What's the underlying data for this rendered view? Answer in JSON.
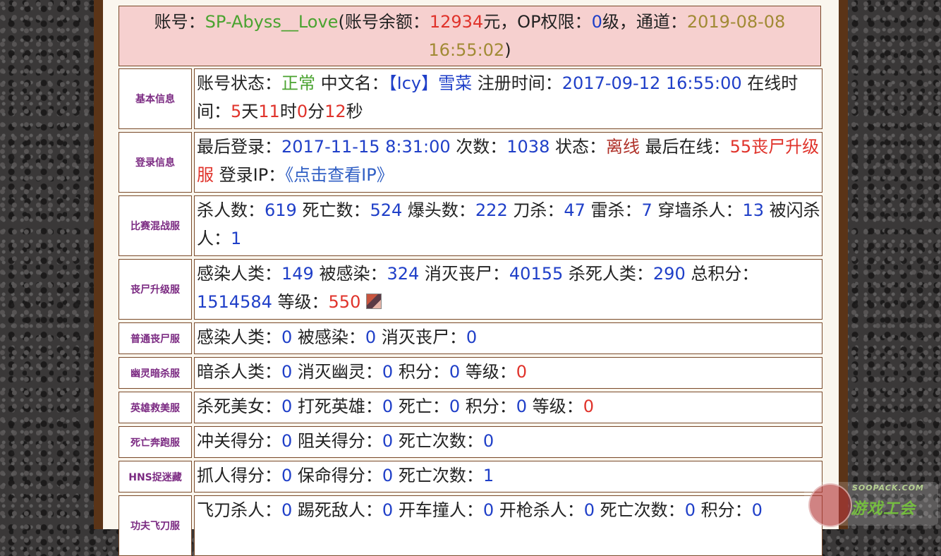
{
  "header": {
    "account_label": "账号：",
    "account_name": "SP-Abyss__Love",
    "balance_open": "(账号余额：",
    "balance_value": "12934",
    "balance_unit": "元，OP权限：",
    "op_level": "0",
    "op_unit": "级，通道：",
    "channel_date": "2019-08-08 16:55:02",
    "close_paren": ")"
  },
  "rows": {
    "basic": {
      "label": "基本信息",
      "status_label": "账号状态：",
      "status_value": "正常",
      "cn_label": " 中文名：",
      "cn_value": "【Icy】雪菜",
      "reg_label": " 注册时间：",
      "reg_value": "2017-09-12 16:55:00",
      "online_label": " 在线时间：",
      "d": "5",
      "d_u": "天",
      "h": "11",
      "h_u": "时",
      "m": "0",
      "m_u": "分",
      "s": "12",
      "s_u": "秒"
    },
    "login": {
      "label": "登录信息",
      "last_label": "最后登录：",
      "last_value": "2017-11-15 8:31:00",
      "count_label": " 次数：",
      "count_value": "1038",
      "state_label": " 状态：",
      "state_value": "离线",
      "lastonline_label": " 最后在线：",
      "lastonline_value": "55丧尸升级服",
      "ip_label": " 登录IP：",
      "ip_link": "《点击查看IP》"
    },
    "mixed": {
      "label": "比赛混战服",
      "kills_label": "杀人数：",
      "kills": "619",
      "deaths_label": " 死亡数：",
      "deaths": "524",
      "hs_label": " 爆头数：",
      "hs": "222",
      "knife_label": " 刀杀：",
      "knife": "47",
      "nade_label": " 雷杀：",
      "nade": "7",
      "wall_label": " 穿墙杀人：",
      "wall": "13",
      "flash_label": " 被闪杀人：",
      "flash": "1"
    },
    "zombie_up": {
      "label": "丧尸升级服",
      "infect_label": "感染人类：",
      "infect": "149",
      "infected_label": " 被感染：",
      "infected": "324",
      "kz_label": " 消灭丧尸：",
      "kz": "40155",
      "kh_label": " 杀死人类：",
      "kh": "290",
      "score_label": " 总积分：",
      "score": "1514584",
      "level_label": " 等级：",
      "level": "550"
    },
    "zombie": {
      "label": "普通丧尸服",
      "infect_label": "感染人类：",
      "infect": "0",
      "infected_label": " 被感染：",
      "infected": "0",
      "kz_label": " 消灭丧尸：",
      "kz": "0"
    },
    "ghost": {
      "label": "幽灵暗杀服",
      "a_label": "暗杀人类：",
      "a": "0",
      "b_label": " 消灭幽灵：",
      "b": "0",
      "c_label": " 积分：",
      "c": "0",
      "d_label": " 等级：",
      "d": "0"
    },
    "hero": {
      "label": "英雄救美服",
      "a_label": "杀死美女：",
      "a": "0",
      "b_label": " 打死英雄：",
      "b": "0",
      "c_label": " 死亡：",
      "c": "0",
      "d_label": " 积分：",
      "d": "0",
      "e_label": " 等级：",
      "e": "0"
    },
    "death_run": {
      "label": "死亡奔跑服",
      "a_label": "冲关得分：",
      "a": "0",
      "b_label": " 阻关得分：",
      "b": "0",
      "c_label": " 死亡次数：",
      "c": "0"
    },
    "hns": {
      "label": "HNS捉迷藏",
      "a_label": "抓人得分：",
      "a": "0",
      "b_label": " 保命得分：",
      "b": "0",
      "c_label": " 死亡次数：",
      "c": "1"
    },
    "kungfu": {
      "label": "功夫飞刀服",
      "a_label": "飞刀杀人：",
      "a": "0",
      "b_label": " 踢死敌人：",
      "b": "0",
      "c_label": " 开车撞人：",
      "c": "0",
      "d_label": " 开枪杀人：",
      "d": "0",
      "e_label": " 死亡次数：",
      "e": "0",
      "f_label": " 积分：",
      "f": "0"
    }
  },
  "watermark": {
    "top": "SOOPACK.COM",
    "main": "游戏工会"
  }
}
